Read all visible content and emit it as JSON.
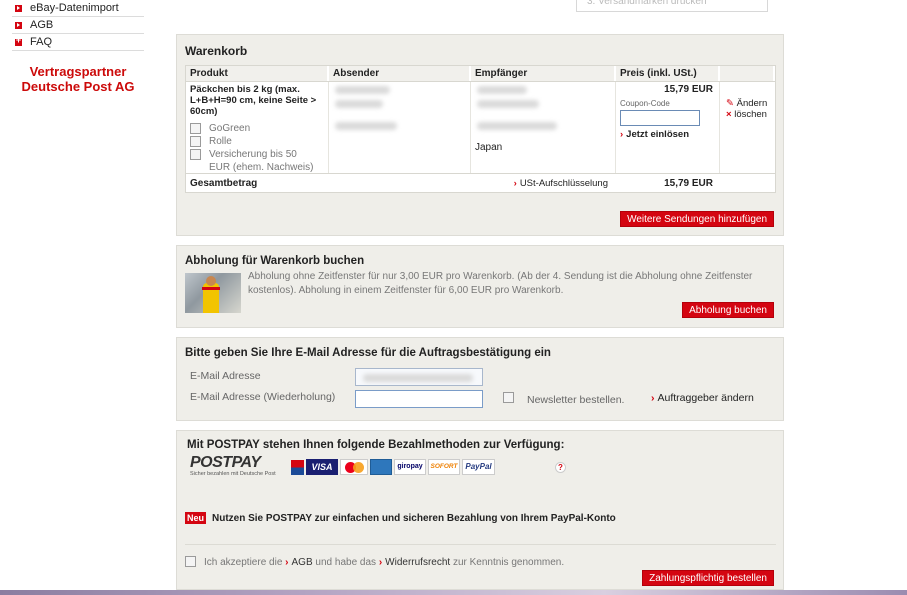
{
  "nav": {
    "items": [
      {
        "label": "eBay-Datenimport",
        "icon": "arrow-bullet"
      },
      {
        "label": "AGB",
        "icon": "arrow-bullet"
      },
      {
        "label": "FAQ",
        "icon": "plus-bullet"
      }
    ],
    "partner_line1": "Vertragspartner",
    "partner_line2": "Deutsche Post AG"
  },
  "top_stub": "3. Versandmarken drucken",
  "cart": {
    "title": "Warenkorb",
    "columns": [
      "Produkt",
      "Absender",
      "Empfänger",
      "Preis (inkl. USt.)"
    ],
    "item": {
      "product": "Päckchen bis 2 kg (max. L+B+H=90 cm, keine Seite > 60cm)",
      "options": [
        "GoGreen",
        "Rolle",
        "Versicherung bis 50 EUR (ehem. Nachweis)"
      ],
      "recipient_country": "Japan",
      "price": "15,79 EUR",
      "coupon_label": "Coupon-Code",
      "coupon_value": "",
      "redeem_label": "Jetzt einlösen",
      "edit_label": "Ändern",
      "delete_label": "löschen"
    },
    "total_label": "Gesamtbetrag",
    "vat_link": "USt-Aufschlüsselung",
    "total_price": "15,79 EUR",
    "add_button": "Weitere Sendungen hinzufügen"
  },
  "pickup": {
    "title": "Abholung für Warenkorb buchen",
    "text": "Abholung ohne Zeitfenster für nur 3,00 EUR pro Warenkorb. (Ab der 4. Sendung ist die Abholung ohne Zeitfenster kostenlos). Abholung in einem Zeitfenster für 6,00 EUR pro Warenkorb.",
    "button": "Abholung buchen"
  },
  "email": {
    "title": "Bitte geben Sie Ihre E-Mail Adresse für die Auftragsbestätigung ein",
    "label1": "E-Mail Adresse",
    "label2": "E-Mail Adresse (Wiederholung)",
    "value1": "",
    "value2": "",
    "newsletter": "Newsletter bestellen.",
    "change_link": "Auftraggeber ändern"
  },
  "payment": {
    "title": "Mit POSTPAY stehen Ihnen folgende Bezahlmethoden zur Verfügung:",
    "logo": "POSTPAY",
    "logo_sub": "Sicher bezahlen mit Deutsche Post",
    "methods": [
      "VISA",
      "MasterCard",
      "AMEX",
      "giropay",
      "SOFORT",
      "PayPal"
    ],
    "help_icon": "?",
    "new_badge": "Neu",
    "new_text": "Nutzen Sie POSTPAY zur einfachen und sicheren Bezahlung von Ihrem PayPal-Konto",
    "accept_pre": "Ich akzeptiere die",
    "accept_agb": "AGB",
    "accept_mid": "und habe das",
    "accept_widerruf": "Widerrufsrecht",
    "accept_post": "zur Kenntnis genommen.",
    "order_button": "Zahlungspflichtig bestellen"
  },
  "colors": {
    "accent": "#d40511",
    "panel": "#efeee9",
    "partner": "#cc0a0a"
  }
}
